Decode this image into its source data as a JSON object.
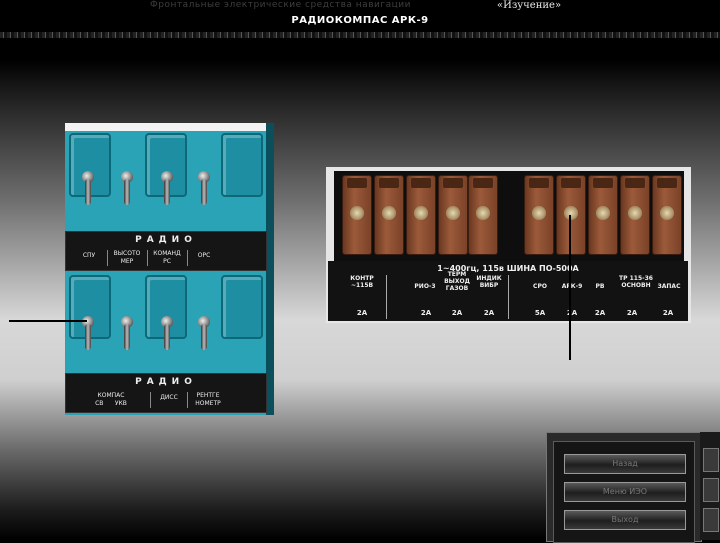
{
  "header": {
    "line1": "Фронтальные электрические средства навигации",
    "badge": "«Изучение»",
    "title": "РАДИОКОМПАС АРК-9"
  },
  "left_panel": {
    "top_plate": {
      "title": "РАДИО",
      "items": [
        "СПУ",
        "ВЫСОТО\nМЕР",
        "КОМАНД\nРС",
        "ОРС"
      ]
    },
    "bottom_plate": {
      "title": "РАДИО",
      "items": [
        "КОМПАС\nСВ      УКВ",
        "ДИСС",
        "РЕНТГЕ\nНОМЕТР"
      ]
    }
  },
  "right_panel": {
    "title": "1~400гц, 115в ШИНА ПО-500А",
    "items": [
      {
        "label": "КОНТР\n~115В",
        "amp": "2А"
      },
      {
        "label": "РИО-3",
        "amp": "2А"
      },
      {
        "label": "ТЕРМ\nВЫХОД\nГАЗОВ",
        "amp": "2А"
      },
      {
        "label": "ИНДИК\nВИБР",
        "amp": "2А"
      },
      {
        "label": "СРО",
        "amp": "5А"
      },
      {
        "label": "АРК-9",
        "amp": "2А"
      },
      {
        "label": "РВ",
        "amp": "2А"
      },
      {
        "label": "ТР 115-36\nОСНОВН",
        "amp": "2А"
      },
      {
        "label": "ЗАПАС",
        "amp": "2А"
      }
    ]
  },
  "nav": {
    "buttons": [
      "Назад",
      "Меню ИЭО",
      "Выход"
    ]
  }
}
